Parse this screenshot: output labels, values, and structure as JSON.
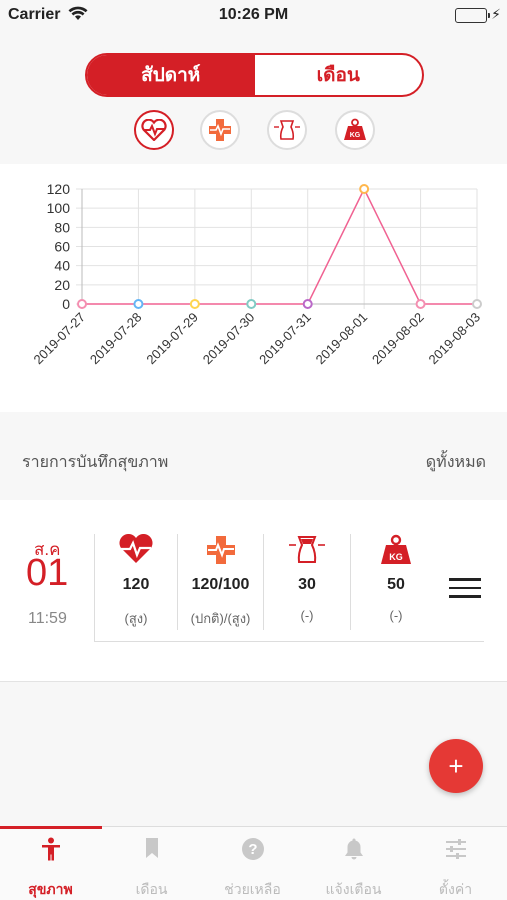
{
  "status_bar": {
    "carrier": "Carrier",
    "time": "10:26 PM"
  },
  "segmented": {
    "week_label": "สัปดาห์",
    "month_label": "เดือน"
  },
  "type_icons": [
    "heart-rate-icon",
    "blood-pressure-icon",
    "waist-icon",
    "weight-kg-icon"
  ],
  "chart_data": {
    "type": "line",
    "x": [
      "2019-07-27",
      "2019-07-28",
      "2019-07-29",
      "2019-07-30",
      "2019-07-31",
      "2019-08-01",
      "2019-08-02",
      "2019-08-03"
    ],
    "series": [
      {
        "values": [
          0,
          0,
          0,
          0,
          0,
          120,
          0,
          0
        ],
        "color": "#f06292"
      }
    ],
    "point_colors": [
      "#f48fb1",
      "#64b5f6",
      "#ffd54f",
      "#80cbc4",
      "#ba68c8",
      "#ffb74d",
      "#f48fb1",
      "#cccccc"
    ],
    "yticks": [
      "0",
      "20",
      "40",
      "60",
      "80",
      "100",
      "120"
    ],
    "ylim": [
      0,
      120
    ],
    "grid": true
  },
  "section": {
    "title": "รายการบันทึกสุขภาพ",
    "see_all": "ดูทั้งหมด"
  },
  "record": {
    "month": "ส.ค",
    "day": "01",
    "time": "11:59",
    "metrics": [
      {
        "icon": "heart-rate-icon",
        "value": "120",
        "status": "(สูง)"
      },
      {
        "icon": "blood-pressure-icon",
        "value": "120/100",
        "status": "(ปกติ)/(สูง)"
      },
      {
        "icon": "waist-icon",
        "value": "30",
        "status": "(-)"
      },
      {
        "icon": "weight-kg-icon",
        "value": "50",
        "status": "(-)"
      }
    ],
    "kg_label": "KG"
  },
  "fab": {
    "label": "+"
  },
  "tabbar": {
    "tabs": [
      {
        "label": "สุขภาพ",
        "icon": "person-icon",
        "active": true
      },
      {
        "label": "เดือน",
        "icon": "bookmark-icon",
        "active": false
      },
      {
        "label": "ช่วยเหลือ",
        "icon": "help-icon",
        "active": false
      },
      {
        "label": "แจ้งเตือน",
        "icon": "bell-icon",
        "active": false
      },
      {
        "label": "ตั้งค่า",
        "icon": "sliders-icon",
        "active": false
      }
    ]
  },
  "colors": {
    "primary": "#d41f26",
    "line": "#f06292"
  }
}
